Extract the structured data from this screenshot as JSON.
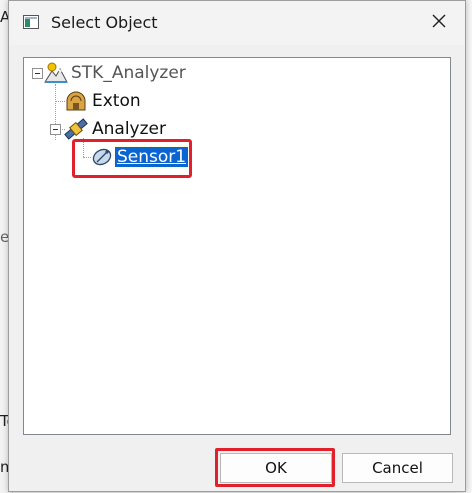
{
  "background": {
    "fragments": [
      "Ac",
      "ele",
      "To",
      "m"
    ]
  },
  "dialog": {
    "title": "Select Object",
    "icons": {
      "title": "window-icon",
      "close": "close-icon"
    }
  },
  "tree": {
    "root": {
      "label": "STK_Analyzer",
      "icon": "scenario-icon",
      "expanded": true
    },
    "items": [
      {
        "label": "Exton",
        "icon": "facility-icon",
        "depth": 1
      },
      {
        "label": "Analyzer",
        "icon": "satellite-icon",
        "depth": 1,
        "expanded": true
      },
      {
        "label": "Sensor1",
        "icon": "sensor-icon",
        "depth": 2,
        "selected": true
      }
    ]
  },
  "buttons": {
    "ok_label": "OK",
    "cancel_label": "Cancel"
  },
  "colors": {
    "highlight": "#e0202a",
    "selection": "#0a64d2"
  }
}
